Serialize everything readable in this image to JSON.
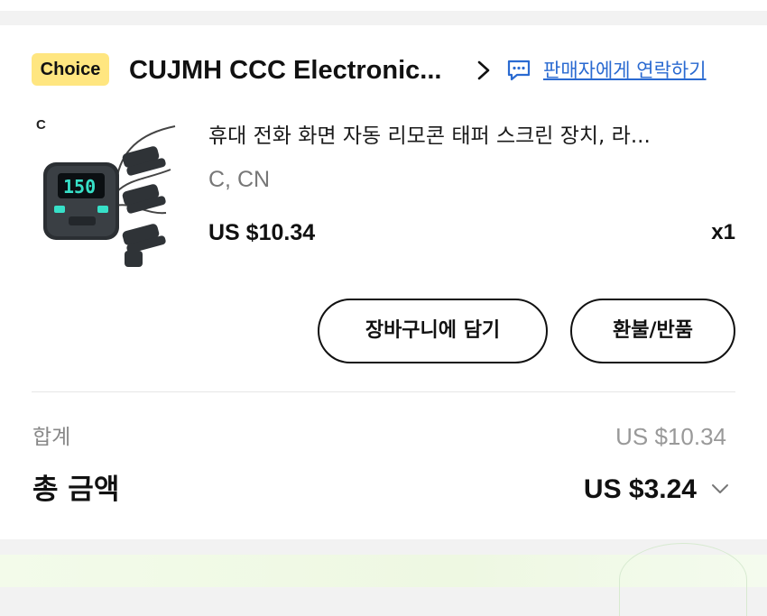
{
  "store": {
    "badge": "Choice",
    "name": "CUJMH CCC Electronic...",
    "contact_label": "판매자에게 연락하기",
    "icons": {
      "chevron": "chevron-right-icon",
      "contact": "chat-message-icon"
    }
  },
  "product": {
    "image_variant_label": "C",
    "title": "휴대 전화 화면 자동 리모콘 태퍼 스크린 장치, 라...",
    "variant": "C, CN",
    "price": "US $10.34",
    "quantity": "x1",
    "image_display": "150"
  },
  "actions": {
    "add_to_cart": "장바구니에 담기",
    "refund_return": "환불/반품"
  },
  "summary": {
    "subtotal_label": "합계",
    "subtotal_value": "US $10.34",
    "total_label": "총 금액",
    "total_value": "US $3.24",
    "icons": {
      "expand": "chevron-down-icon"
    }
  },
  "colors": {
    "badge_bg": "#ffe680",
    "link": "#2a6ad1",
    "text": "#111111",
    "muted": "#888888",
    "device_display": "#37e0c8"
  }
}
